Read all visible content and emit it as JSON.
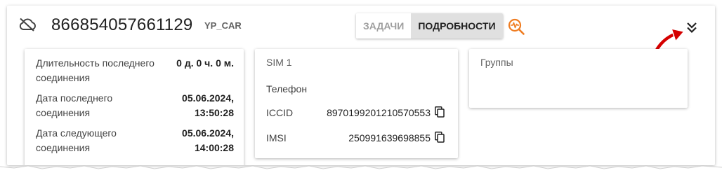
{
  "header": {
    "device_id": "866854057661129",
    "device_model": "YP_CAR",
    "icons": [
      "cloud-offline-icon",
      "diagnostics-search-icon",
      "expand-more-icon"
    ]
  },
  "tabs": [
    {
      "label": "ЗАДАЧИ",
      "active": false
    },
    {
      "label": "ПОДРОБНОСТИ",
      "active": true
    }
  ],
  "stats": [
    {
      "label": "Длительность последнего соединения",
      "value": "0 д. 0 ч. 0 м."
    },
    {
      "label": "Дата последнего соединения",
      "value": "05.06.2024, 13:50:28"
    },
    {
      "label": "Дата следующего соединения",
      "value": "05.06.2024, 14:00:28"
    }
  ],
  "sim": {
    "title": "SIM 1",
    "phone_label": "Телефон",
    "iccid_label": "ICCID",
    "iccid_value": "8970199201210570553",
    "imsi_label": "IMSI",
    "imsi_value": "250991639698855"
  },
  "groups": {
    "title": "Группы"
  },
  "colors": {
    "accent_orange": "#ef7d22",
    "annotation_red": "#d50000",
    "active_tab_bg": "#e0e0e0",
    "inactive_tab_text": "#9e9e9e"
  }
}
